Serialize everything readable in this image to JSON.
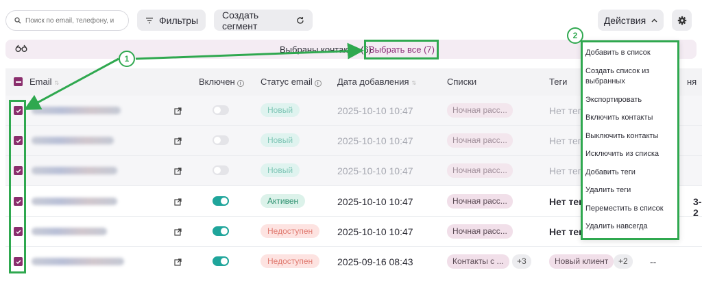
{
  "toolbar": {
    "search_placeholder": "Поиск по email, телефону, и",
    "filter_label": "Фильтры",
    "segment_label": "Создать сегмент",
    "actions_label": "Действия"
  },
  "banner": {
    "selected_text": "Выбраны контакты (6)",
    "select_all": "Выбрать все (7)"
  },
  "table": {
    "headers": {
      "email": "Email",
      "enabled": "Включен",
      "status": "Статус email",
      "date": "Дата добавления",
      "lists": "Списки",
      "tags": "Теги",
      "extra": "ня"
    },
    "rows": [
      {
        "enabled": false,
        "status": "Новый",
        "status_kind": "new",
        "date": "2025-10-10 10:47",
        "list": "Ночная расс...",
        "tags": "Нет теги",
        "muted": true
      },
      {
        "enabled": false,
        "status": "Новый",
        "status_kind": "new",
        "date": "2025-10-10 10:47",
        "list": "Ночная расс...",
        "tags": "Нет теги",
        "muted": true
      },
      {
        "enabled": false,
        "status": "Новый",
        "status_kind": "new",
        "date": "2025-10-10 10:47",
        "list": "Ночная расс...",
        "tags": "Нет теги",
        "muted": true
      },
      {
        "enabled": true,
        "status": "Активен",
        "status_kind": "active",
        "date": "2025-10-10 10:47",
        "list": "Ночная расс...",
        "tags": "Нет тег",
        "muted": false,
        "extra": "3-2"
      },
      {
        "enabled": true,
        "status": "Недоступен",
        "status_kind": "bad",
        "date": "2025-10-10 10:47",
        "list": "Ночная расс...",
        "tags": "Нет тег",
        "muted": false
      },
      {
        "enabled": true,
        "status": "Недоступен",
        "status_kind": "bad",
        "date": "2025-09-16 08:43",
        "list": "Контакты с ...",
        "list_more": "+3",
        "tag_label": "Новый клиент",
        "tag_more": "+2",
        "extra": "--",
        "muted": false
      }
    ]
  },
  "dropdown": {
    "items": [
      "Добавить в список",
      "Создать список из выбранных",
      "Экспортировать",
      "Включить контакты",
      "Выключить контакты",
      "Исключить из списка",
      "Добавить теги",
      "Удалить теги",
      "Переместить в список",
      "Удалить навсегда"
    ]
  },
  "annotations": {
    "badge1": "1",
    "badge2": "2"
  },
  "colors": {
    "accent": "#8a2e6d",
    "highlight": "#2fa84f",
    "toggle_on": "#1fa59b"
  }
}
